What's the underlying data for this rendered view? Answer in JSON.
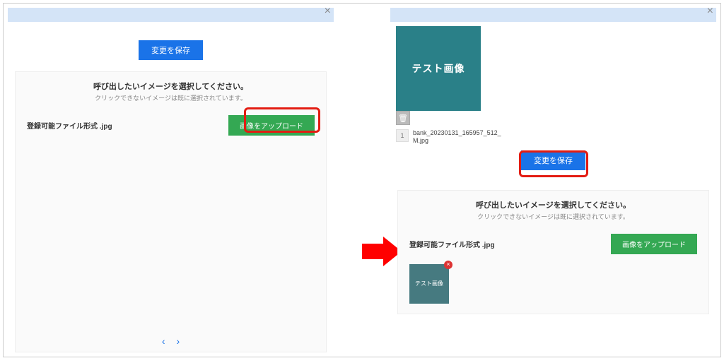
{
  "common": {
    "close_glyph": "×",
    "save_label": "変更を保存",
    "card_title": "呼び出したいイメージを選択してください。",
    "card_sub": "クリックできないイメージは既に選択されています。",
    "format_label": "登録可能ファイル形式 .jpg",
    "upload_label": "画像をアップロード",
    "pager_prev": "‹",
    "pager_next": "›"
  },
  "right": {
    "preview_text": "テスト画像",
    "trash_glyph": "🗑",
    "file_index": "1",
    "filename": "bank_20230131_165957_512_M.jpg",
    "thumb_text": "テスト画像",
    "thumb_x": "×"
  }
}
